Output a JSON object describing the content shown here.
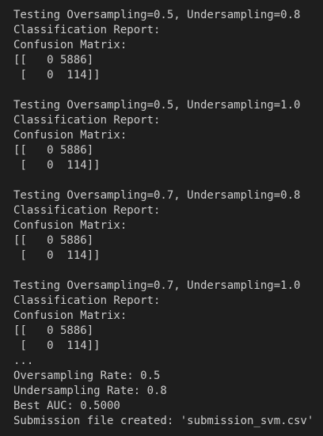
{
  "theme": {
    "background": "#1e1e1e",
    "text": "#cccccc"
  },
  "output": {
    "lines": [
      "Testing Oversampling=0.5, Undersampling=0.8",
      "Classification Report:",
      "Confusion Matrix:",
      "[[   0 5886]",
      " [   0  114]]",
      "",
      "Testing Oversampling=0.5, Undersampling=1.0",
      "Classification Report:",
      "Confusion Matrix:",
      "[[   0 5886]",
      " [   0  114]]",
      "",
      "Testing Oversampling=0.7, Undersampling=0.8",
      "Classification Report:",
      "Confusion Matrix:",
      "[[   0 5886]",
      " [   0  114]]",
      "",
      "Testing Oversampling=0.7, Undersampling=1.0",
      "Classification Report:",
      "Confusion Matrix:",
      "[[   0 5886]",
      " [   0  114]]",
      "...",
      "Oversampling Rate: 0.5",
      "Undersampling Rate: 0.8",
      "Best AUC: 0.5000",
      "Submission file created: 'submission_svm.csv'"
    ]
  }
}
